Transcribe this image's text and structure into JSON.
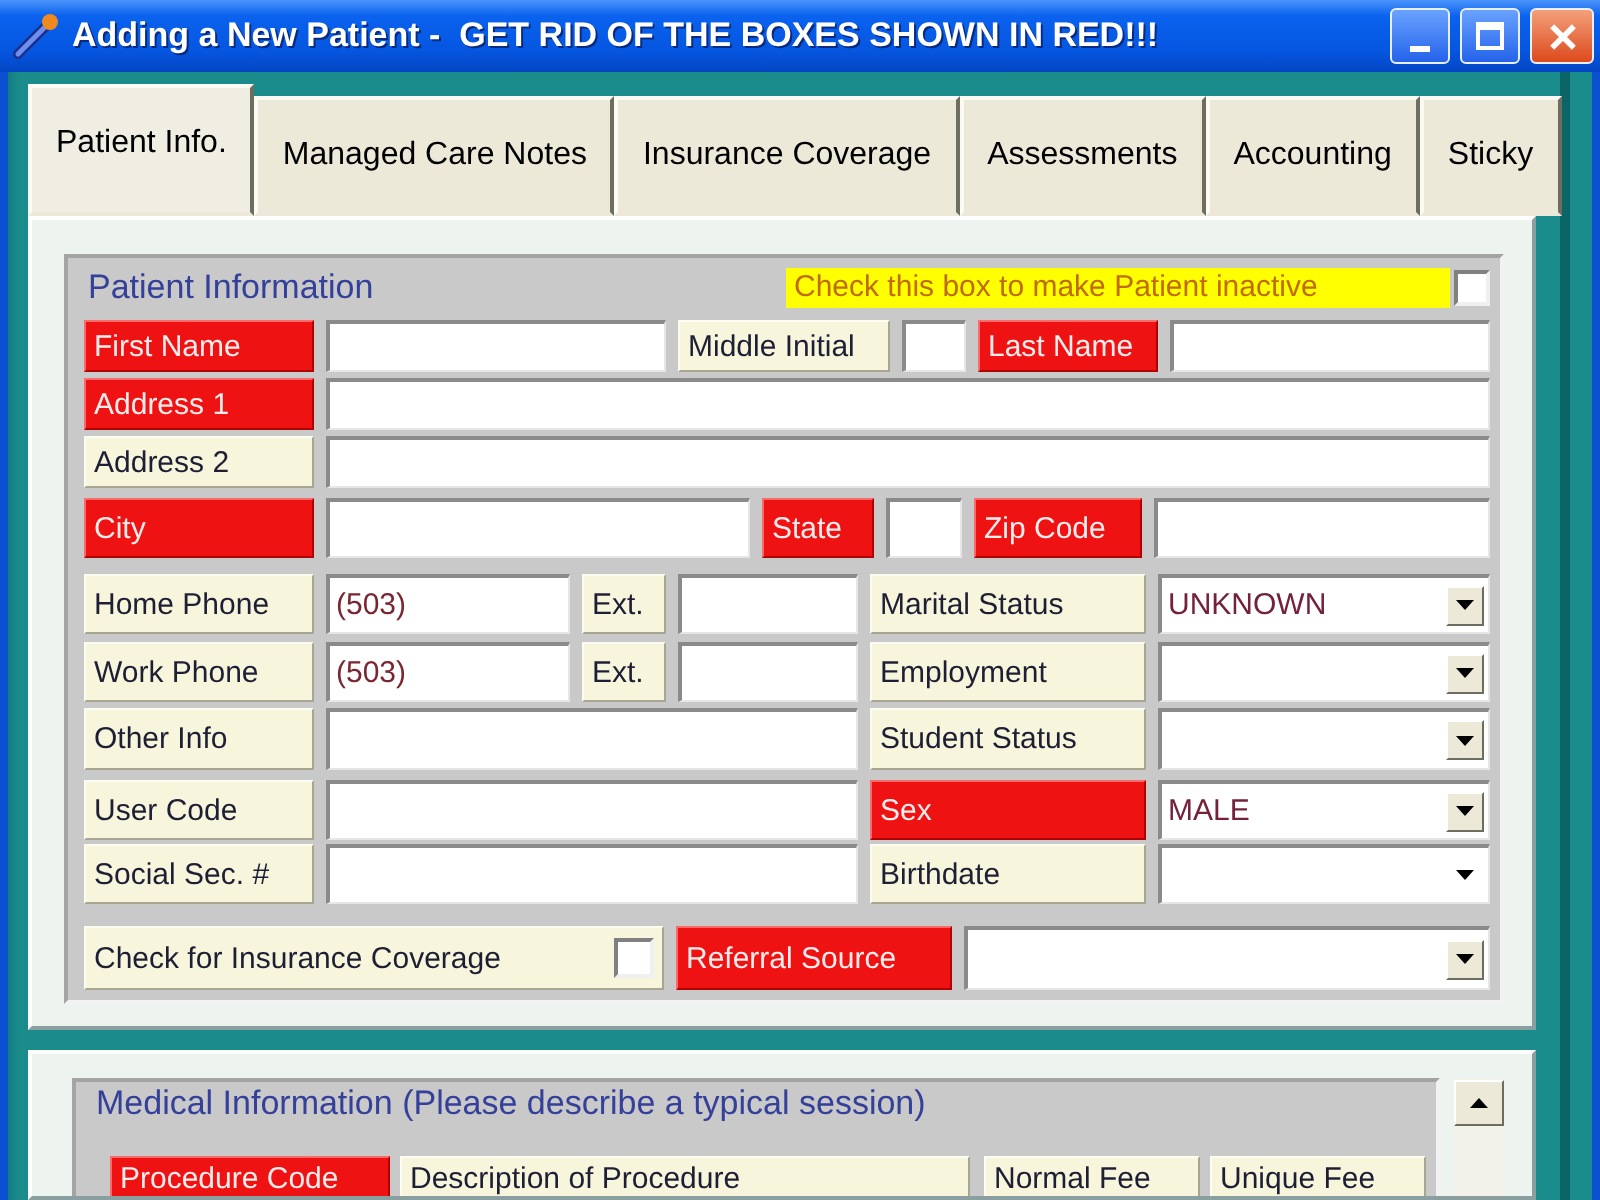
{
  "window": {
    "title": "Adding a New Patient -  GET RID OF THE BOXES SHOWN IN RED!!!"
  },
  "tabs": [
    {
      "label": "Patient Info.",
      "selected": true
    },
    {
      "label": "Managed Care Notes",
      "selected": false
    },
    {
      "label": "Insurance Coverage",
      "selected": false
    },
    {
      "label": "Assessments",
      "selected": false
    },
    {
      "label": "Accounting",
      "selected": false
    },
    {
      "label": "Sticky",
      "selected": false
    }
  ],
  "patient_information": {
    "title": "Patient Information",
    "inactive_option": {
      "label": "Check this box to make Patient inactive",
      "checked": false
    },
    "rows": [
      {
        "cells": [
          {
            "kind": "label",
            "text": "First Name",
            "highlighted": true
          },
          {
            "kind": "input"
          },
          {
            "kind": "label",
            "text": "Middle Initial",
            "highlighted": false
          },
          {
            "kind": "input"
          },
          {
            "kind": "label",
            "text": "Last Name",
            "highlighted": true
          },
          {
            "kind": "input"
          }
        ]
      },
      {
        "cells": [
          {
            "kind": "label",
            "text": "Address 1",
            "highlighted": true
          },
          {
            "kind": "input"
          }
        ]
      },
      {
        "cells": [
          {
            "kind": "label",
            "text": "Address 2",
            "highlighted": false
          },
          {
            "kind": "input"
          }
        ]
      },
      {
        "cells": [
          {
            "kind": "label",
            "text": "City",
            "highlighted": true
          },
          {
            "kind": "input"
          },
          {
            "kind": "label",
            "text": "State",
            "highlighted": true
          },
          {
            "kind": "input"
          },
          {
            "kind": "label",
            "text": "Zip Code",
            "highlighted": true
          },
          {
            "kind": "input"
          }
        ]
      },
      {
        "cells": [
          {
            "kind": "label",
            "text": "Home Phone",
            "highlighted": false
          },
          {
            "kind": "input",
            "value": "(503)"
          },
          {
            "kind": "label",
            "text": "Ext.",
            "highlighted": false
          },
          {
            "kind": "input"
          },
          {
            "kind": "label",
            "text": "Marital Status",
            "highlighted": false
          },
          {
            "kind": "dropdown",
            "value": "UNKNOWN"
          }
        ]
      },
      {
        "cells": [
          {
            "kind": "label",
            "text": "Work Phone",
            "highlighted": false
          },
          {
            "kind": "input",
            "value": "(503)"
          },
          {
            "kind": "label",
            "text": "Ext.",
            "highlighted": false
          },
          {
            "kind": "input"
          },
          {
            "kind": "label",
            "text": "Employment",
            "highlighted": false
          },
          {
            "kind": "dropdown"
          }
        ]
      },
      {
        "cells": [
          {
            "kind": "label",
            "text": "Other Info",
            "highlighted": false
          },
          {
            "kind": "input"
          },
          {
            "kind": "label",
            "text": "Student Status",
            "highlighted": false
          },
          {
            "kind": "dropdown"
          }
        ]
      },
      {
        "cells": [
          {
            "kind": "label",
            "text": "User Code",
            "highlighted": false
          },
          {
            "kind": "input"
          },
          {
            "kind": "label",
            "text": "Sex",
            "highlighted": true
          },
          {
            "kind": "dropdown",
            "value": "MALE"
          }
        ]
      },
      {
        "cells": [
          {
            "kind": "label",
            "text": "Social Sec. #",
            "highlighted": false
          },
          {
            "kind": "input"
          },
          {
            "kind": "label",
            "text": "Birthdate",
            "highlighted": false
          },
          {
            "kind": "date"
          }
        ]
      },
      {
        "cells": [
          {
            "kind": "checkbox",
            "label": "Check for Insurance Coverage",
            "checked": false
          },
          {
            "kind": "label",
            "text": "Referral Source",
            "highlighted": true
          },
          {
            "kind": "dropdown"
          }
        ]
      }
    ]
  },
  "medical_information": {
    "title": "Medical Information (Please describe a typical session)",
    "columns": [
      {
        "label": "Procedure Code",
        "highlighted": true
      },
      {
        "label": "Description of Procedure",
        "highlighted": false
      },
      {
        "label": "Normal Fee",
        "highlighted": false
      },
      {
        "label": "Unique Fee",
        "highlighted": false
      }
    ]
  }
}
